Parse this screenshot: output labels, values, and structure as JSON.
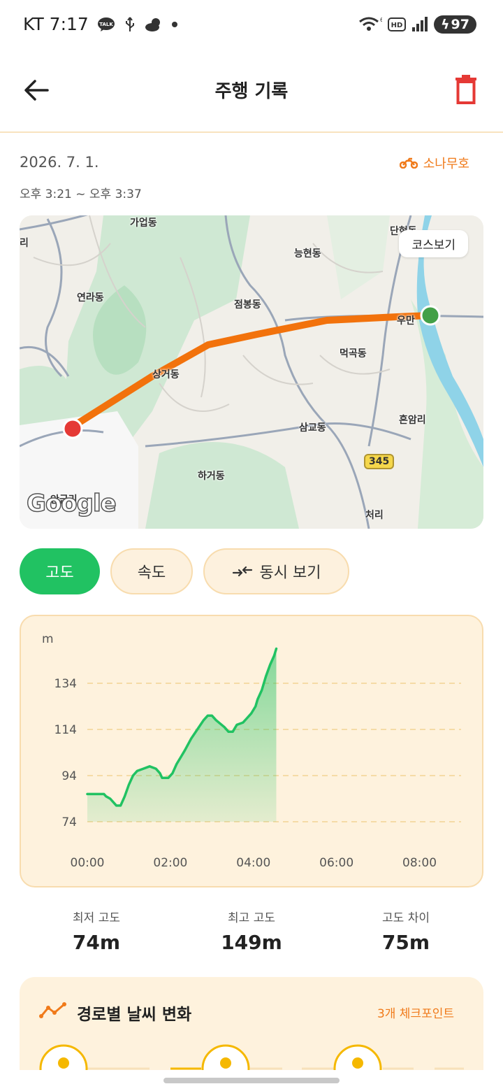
{
  "status_bar": {
    "carrier_time": "KT 7:17",
    "battery": "97",
    "talk_badge": "TALK"
  },
  "header": {
    "title": "주행 기록"
  },
  "ride": {
    "date": "2026. 7. 1.",
    "time_range": "오후 3:21 ~ 오후 3:37",
    "vehicle": "소나무호"
  },
  "map": {
    "course_button": "코스보기",
    "labels": [
      "가업동",
      "능현동",
      "연라동",
      "점봉동",
      "우만",
      "먹곡동",
      "상거동",
      "삼교동",
      "흔암리",
      "하거동",
      "처리",
      "단현동",
      "리",
      "안금리"
    ],
    "route_number": "345",
    "attribution": "Google"
  },
  "tabs": {
    "altitude": "고도",
    "speed": "속도",
    "both": "동시 보기"
  },
  "chart_data": {
    "type": "area",
    "title": "",
    "ylabel": "m",
    "xlabel": "",
    "x_tick_labels": [
      "00:00",
      "02:00",
      "04:00",
      "06:00",
      "08:00"
    ],
    "y_tick_labels": [
      "134",
      "114",
      "94",
      "74"
    ],
    "ylim": [
      70,
      150
    ],
    "xlim": [
      0,
      9
    ],
    "grid": true,
    "series": [
      {
        "color": "#21c262",
        "points": [
          [
            0,
            86
          ],
          [
            0.4,
            86
          ],
          [
            0.45,
            85
          ],
          [
            0.55,
            84
          ],
          [
            0.7,
            81
          ],
          [
            0.8,
            81
          ],
          [
            0.9,
            85
          ],
          [
            1.0,
            90
          ],
          [
            1.1,
            94
          ],
          [
            1.2,
            96
          ],
          [
            1.35,
            97
          ],
          [
            1.5,
            98
          ],
          [
            1.65,
            97
          ],
          [
            1.75,
            95
          ],
          [
            1.8,
            93
          ],
          [
            1.95,
            93
          ],
          [
            2.05,
            95
          ],
          [
            2.15,
            99
          ],
          [
            2.25,
            102
          ],
          [
            2.35,
            105
          ],
          [
            2.5,
            110
          ],
          [
            2.65,
            114
          ],
          [
            2.8,
            118
          ],
          [
            2.9,
            120
          ],
          [
            3.0,
            120
          ],
          [
            3.1,
            118
          ],
          [
            3.3,
            115
          ],
          [
            3.4,
            113
          ],
          [
            3.5,
            113
          ],
          [
            3.6,
            116
          ],
          [
            3.75,
            117
          ],
          [
            3.85,
            119
          ],
          [
            3.95,
            121
          ],
          [
            4.05,
            124
          ],
          [
            4.1,
            127
          ],
          [
            4.2,
            131
          ],
          [
            4.3,
            137
          ],
          [
            4.4,
            142
          ],
          [
            4.5,
            146
          ],
          [
            4.55,
            149
          ]
        ]
      }
    ]
  },
  "stats": [
    {
      "label": "최저 고도",
      "value": "74m"
    },
    {
      "label": "최고 고도",
      "value": "149m"
    },
    {
      "label": "고도 차이",
      "value": "75m"
    }
  ],
  "weather": {
    "title": "경로별 날씨 변화",
    "checkpoints": "3개 체크포인트"
  },
  "colors": {
    "accent": "#f07a1a",
    "primary_green": "#21c262",
    "card_bg": "#fef2dd",
    "delete_red": "#e53935"
  }
}
